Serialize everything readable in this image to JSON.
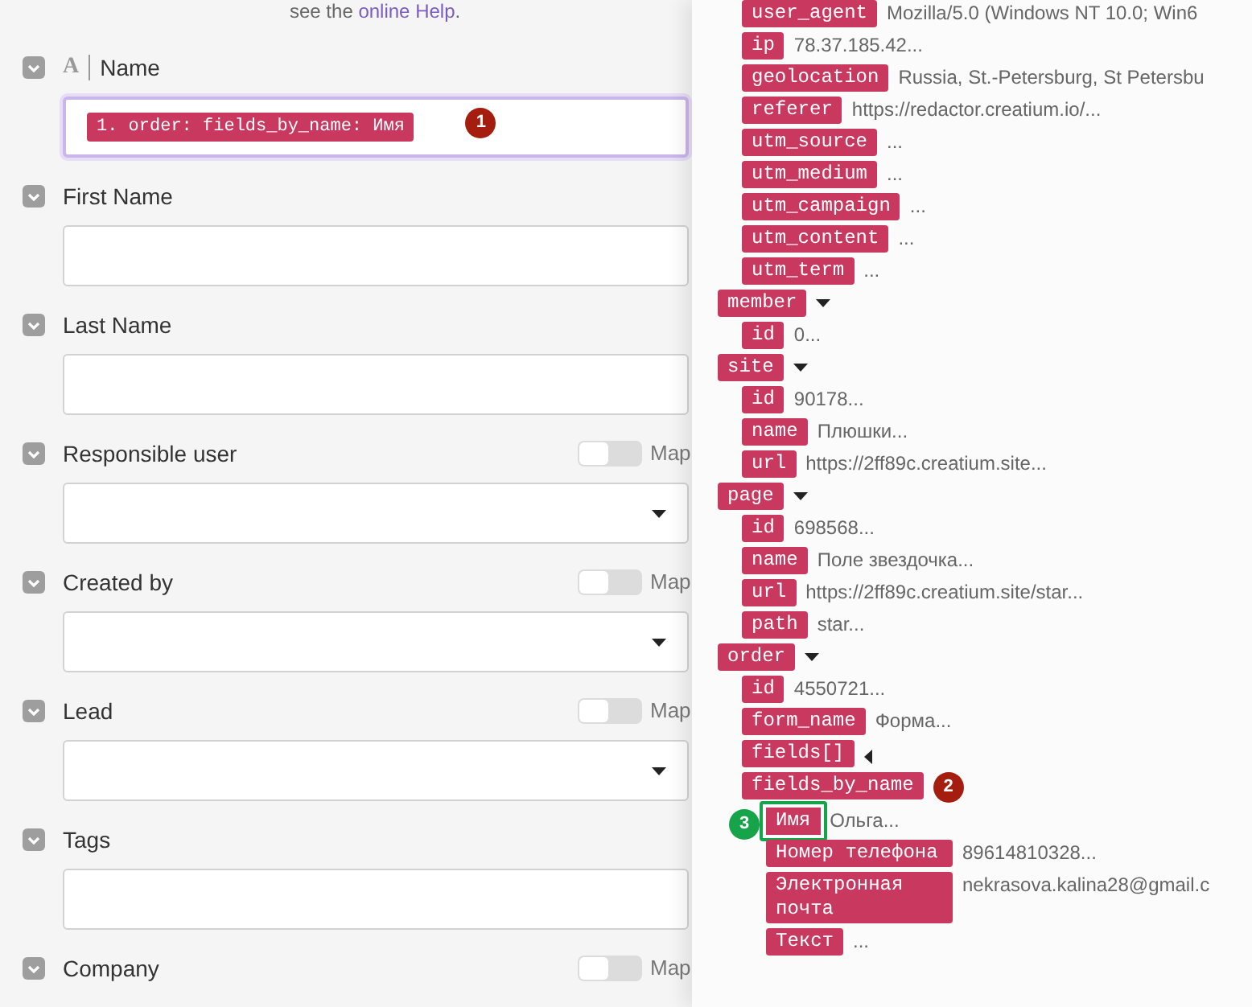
{
  "help_text": {
    "before": "see the ",
    "link": "online Help",
    "after": "."
  },
  "fields": [
    {
      "kind": "mapped",
      "label": "Name",
      "type_letter": "A",
      "value_tag": "1. order: fields_by_name: Имя",
      "focused": true,
      "badge": {
        "text": "1",
        "color": "#a51d0f"
      }
    },
    {
      "kind": "text",
      "label": "First Name",
      "focused": false
    },
    {
      "kind": "text",
      "label": "Last Name",
      "focused": false
    },
    {
      "kind": "select",
      "label": "Responsible user",
      "focused": false,
      "map": {
        "on": false,
        "label": "Map"
      }
    },
    {
      "kind": "select",
      "label": "Created by",
      "focused": false,
      "map": {
        "on": false,
        "label": "Map"
      }
    },
    {
      "kind": "select",
      "label": "Lead",
      "focused": false,
      "map": {
        "on": false,
        "label": "Map"
      }
    },
    {
      "kind": "text",
      "label": "Tags",
      "focused": false
    },
    {
      "kind": "header",
      "label": "Company",
      "map": {
        "on": false,
        "label": "Map"
      }
    }
  ],
  "tree": {
    "continued_children": [
      {
        "key": "user_agent",
        "value": "Mozilla/5.0 (Windows NT 10.0; Win6"
      },
      {
        "key": "ip",
        "value": "78.37.185.42..."
      },
      {
        "key": "geolocation",
        "value": "Russia, St.-Petersburg, St Petersbu"
      },
      {
        "key": "referer",
        "value": "https://redactor.creatium.io/..."
      },
      {
        "key": "utm_source",
        "value": "..."
      },
      {
        "key": "utm_medium",
        "value": "..."
      },
      {
        "key": "utm_campaign",
        "value": "..."
      },
      {
        "key": "utm_content",
        "value": "..."
      },
      {
        "key": "utm_term",
        "value": "..."
      }
    ],
    "nodes": [
      {
        "key": "member",
        "expanded": true,
        "children": [
          {
            "key": "id",
            "value": "0..."
          }
        ]
      },
      {
        "key": "site",
        "expanded": true,
        "children": [
          {
            "key": "id",
            "value": "90178..."
          },
          {
            "key": "name",
            "value": "Плюшки..."
          },
          {
            "key": "url",
            "value": "https://2ff89c.creatium.site..."
          }
        ]
      },
      {
        "key": "page",
        "expanded": true,
        "children": [
          {
            "key": "id",
            "value": "698568..."
          },
          {
            "key": "name",
            "value": "Поле звездочка..."
          },
          {
            "key": "url",
            "value": "https://2ff89c.creatium.site/star..."
          },
          {
            "key": "path",
            "value": "star..."
          }
        ]
      },
      {
        "key": "order",
        "expanded": true,
        "children": [
          {
            "key": "id",
            "value": "4550721..."
          },
          {
            "key": "form_name",
            "value": "Форма..."
          },
          {
            "key": "fields[]",
            "expanded": false
          },
          {
            "key": "fields_by_name",
            "badge": {
              "text": "2",
              "color": "#a51d0f"
            },
            "children": [
              {
                "key": "Имя",
                "value": "Ольга...",
                "highlighted": true,
                "badge": {
                  "text": "3",
                  "color": "#16a34a"
                }
              },
              {
                "key": "Номер телефона",
                "value": "89614810328...",
                "highlighted": false
              },
              {
                "key": "Электронная почта",
                "value": "nekrasova.kalina28@gmail.c",
                "highlighted": false
              },
              {
                "key": "Текст",
                "value": "...",
                "highlighted": false
              }
            ]
          }
        ]
      }
    ]
  }
}
